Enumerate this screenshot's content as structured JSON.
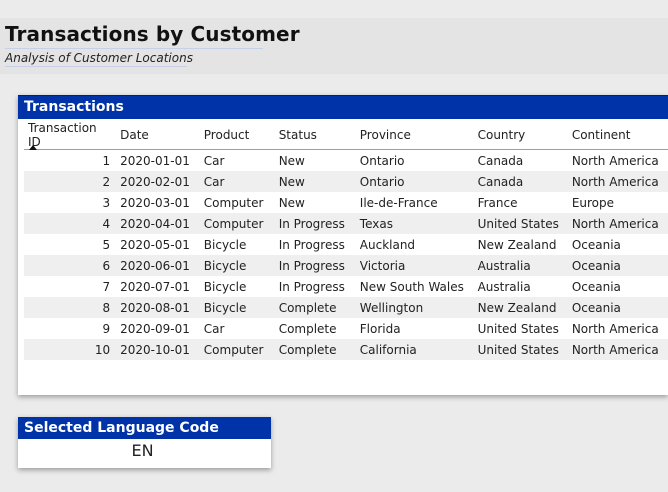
{
  "header": {
    "title": "Transactions by Customer",
    "subtitle": "Analysis of Customer Locations"
  },
  "transactions": {
    "title": "Transactions",
    "columns": [
      "Transaction ID",
      "Date",
      "Product",
      "Status",
      "Province",
      "Country",
      "Continent"
    ],
    "sort_column": "Transaction ID",
    "sort_direction": "ascending",
    "rows": [
      [
        "1",
        "2020-01-01",
        "Car",
        "New",
        "Ontario",
        "Canada",
        "North America"
      ],
      [
        "2",
        "2020-02-01",
        "Car",
        "New",
        "Ontario",
        "Canada",
        "North America"
      ],
      [
        "3",
        "2020-03-01",
        "Computer",
        "New",
        "Ile-de-France",
        "France",
        "Europe"
      ],
      [
        "4",
        "2020-04-01",
        "Computer",
        "In Progress",
        "Texas",
        "United States",
        "North America"
      ],
      [
        "5",
        "2020-05-01",
        "Bicycle",
        "In Progress",
        "Auckland",
        "New Zealand",
        "Oceania"
      ],
      [
        "6",
        "2020-06-01",
        "Bicycle",
        "In Progress",
        "Victoria",
        "Australia",
        "Oceania"
      ],
      [
        "7",
        "2020-07-01",
        "Bicycle",
        "In Progress",
        "New South Wales",
        "Australia",
        "Oceania"
      ],
      [
        "8",
        "2020-08-01",
        "Bicycle",
        "Complete",
        "Wellington",
        "New Zealand",
        "Oceania"
      ],
      [
        "9",
        "2020-09-01",
        "Car",
        "Complete",
        "Florida",
        "United States",
        "North America"
      ],
      [
        "10",
        "2020-10-01",
        "Computer",
        "Complete",
        "California",
        "United States",
        "North America"
      ]
    ]
  },
  "language": {
    "title": "Selected Language Code",
    "value": "EN"
  },
  "colors": {
    "header_blue": "#0033a8",
    "row_stripe": "#efefef",
    "background": "#ebebeb"
  }
}
